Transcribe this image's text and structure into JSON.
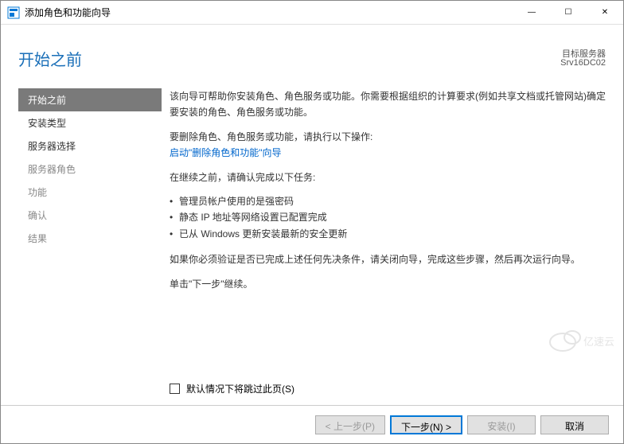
{
  "window": {
    "title": "添加角色和功能向导",
    "minimize": "—",
    "maximize": "☐",
    "close": "✕"
  },
  "header": {
    "page_title": "开始之前",
    "dest_label": "目标服务器",
    "dest_server": "Srv16DC02"
  },
  "nav": {
    "items": [
      {
        "label": "开始之前",
        "state": "active"
      },
      {
        "label": "安装类型",
        "state": "enabled"
      },
      {
        "label": "服务器选择",
        "state": "enabled"
      },
      {
        "label": "服务器角色",
        "state": "disabled"
      },
      {
        "label": "功能",
        "state": "disabled"
      },
      {
        "label": "确认",
        "state": "disabled"
      },
      {
        "label": "结果",
        "state": "disabled"
      }
    ]
  },
  "content": {
    "intro": "该向导可帮助你安装角色、角色服务或功能。你需要根据组织的计算要求(例如共享文档或托管网站)确定要安装的角色、角色服务或功能。",
    "remove_prefix": "要删除角色、角色服务或功能，请执行以下操作:",
    "remove_link": "启动\"删除角色和功能\"向导",
    "before_continue": "在继续之前，请确认完成以下任务:",
    "bullets": [
      "管理员帐户使用的是强密码",
      "静态 IP 地址等网络设置已配置完成",
      "已从 Windows 更新安装最新的安全更新"
    ],
    "verify": "如果你必须验证是否已完成上述任何先决条件，请关闭向导，完成这些步骤，然后再次运行向导。",
    "click_next": "单击\"下一步\"继续。",
    "skip_checkbox": "默认情况下将跳过此页(S)"
  },
  "footer": {
    "prev": "< 上一步(P)",
    "next": "下一步(N) >",
    "install": "安装(I)",
    "cancel": "取消"
  },
  "watermark": "亿速云"
}
